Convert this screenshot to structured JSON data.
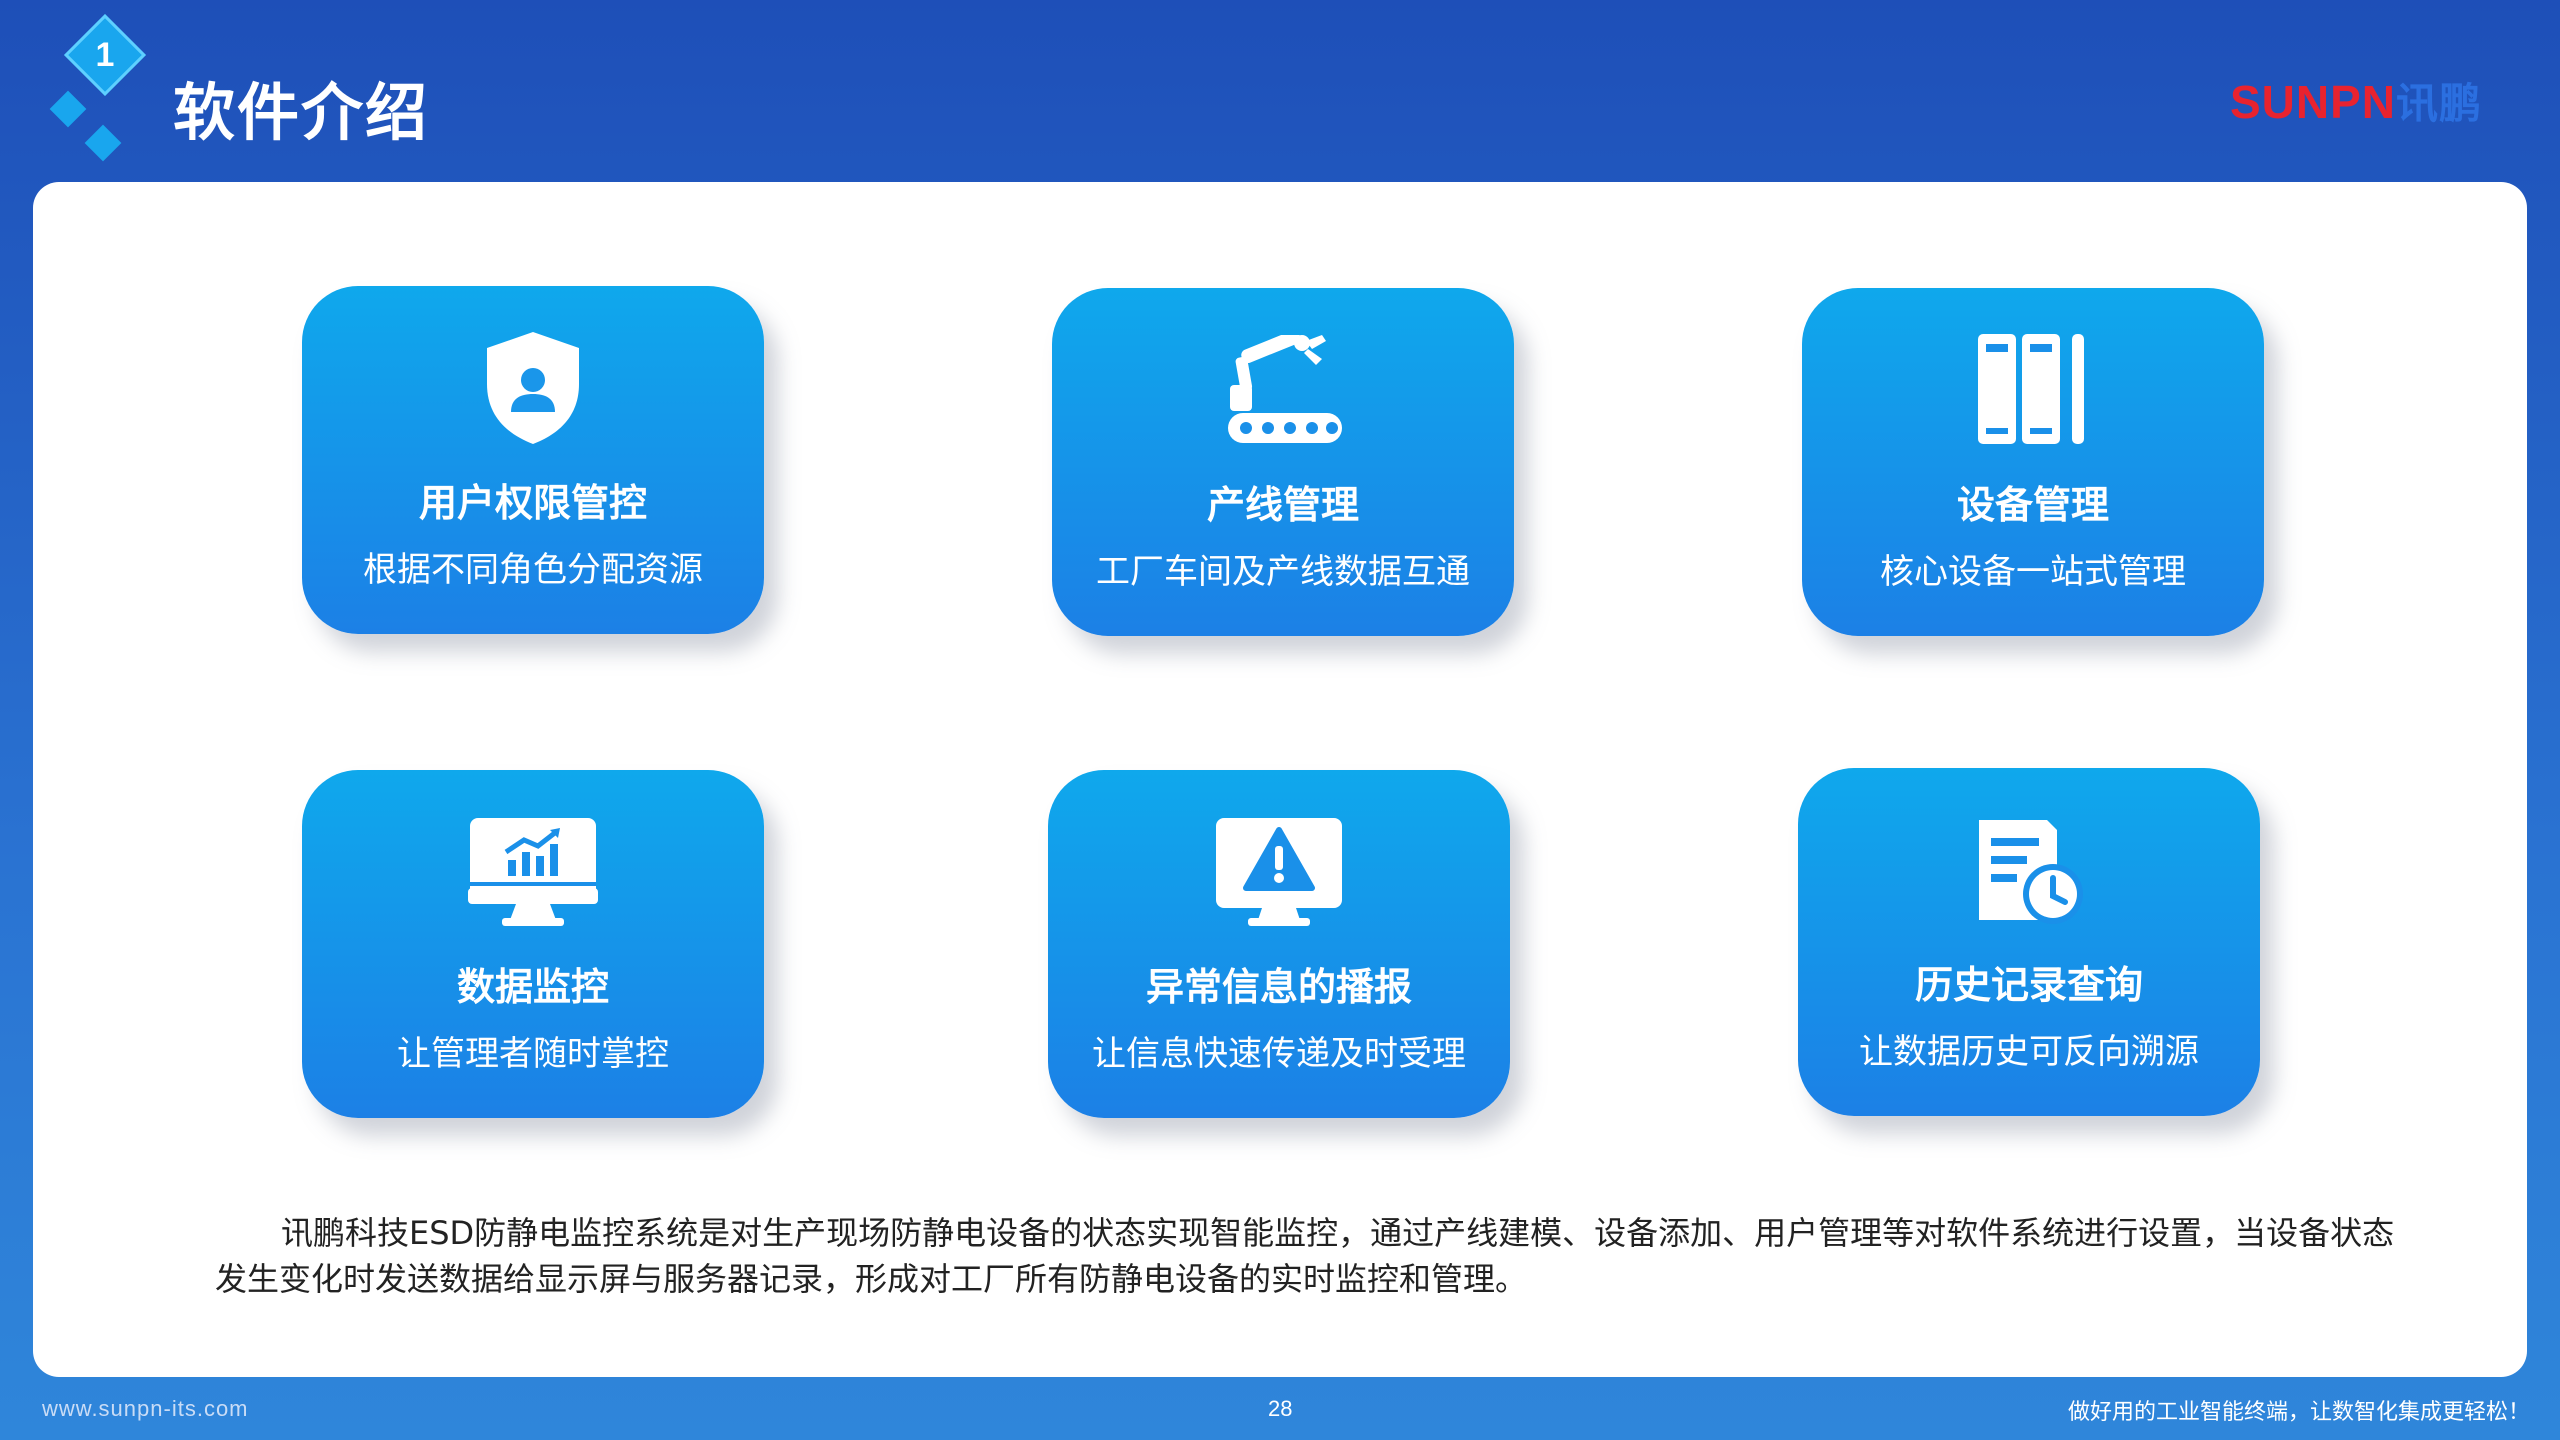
{
  "header": {
    "section_number": "1",
    "title": "软件介绍",
    "brand_en": "SUNPN",
    "brand_cn": "讯鹏"
  },
  "cards": [
    {
      "icon": "shield-user-icon",
      "title": "用户权限管控",
      "desc": "根据不同角色分配资源"
    },
    {
      "icon": "robot-arm-conveyor-icon",
      "title": "产线管理",
      "desc": "工厂车间及产线数据互通"
    },
    {
      "icon": "server-rack-icon",
      "title": "设备管理",
      "desc": "核心设备一站式管理"
    },
    {
      "icon": "monitor-chart-icon",
      "title": "数据监控",
      "desc": "让管理者随时掌控"
    },
    {
      "icon": "warning-monitor-icon",
      "title": "异常信息的播报",
      "desc": "让信息快速传递及时受理"
    },
    {
      "icon": "document-clock-icon",
      "title": "历史记录查询",
      "desc": "让数据历史可反向溯源"
    }
  ],
  "intro": "讯鹏科技ESD防静电监控系统是对生产现场防静电设备的状态实现智能监控，通过产线建模、设备添加、用户管理等对软件系统进行设置，当设备状态发生变化时发送数据给显示屏与服务器记录，形成对工厂所有防静电设备的实时监控和管理。",
  "footer": {
    "website": "www.sunpn-its.com",
    "page": "28",
    "slogan": "做好用的工业智能终端，让数智化集成更轻松！"
  },
  "colors": {
    "background": "#2a6fd0",
    "card": "#1a8ee9",
    "brand_red": "#e8232f",
    "brand_blue": "#2b6fe0"
  }
}
